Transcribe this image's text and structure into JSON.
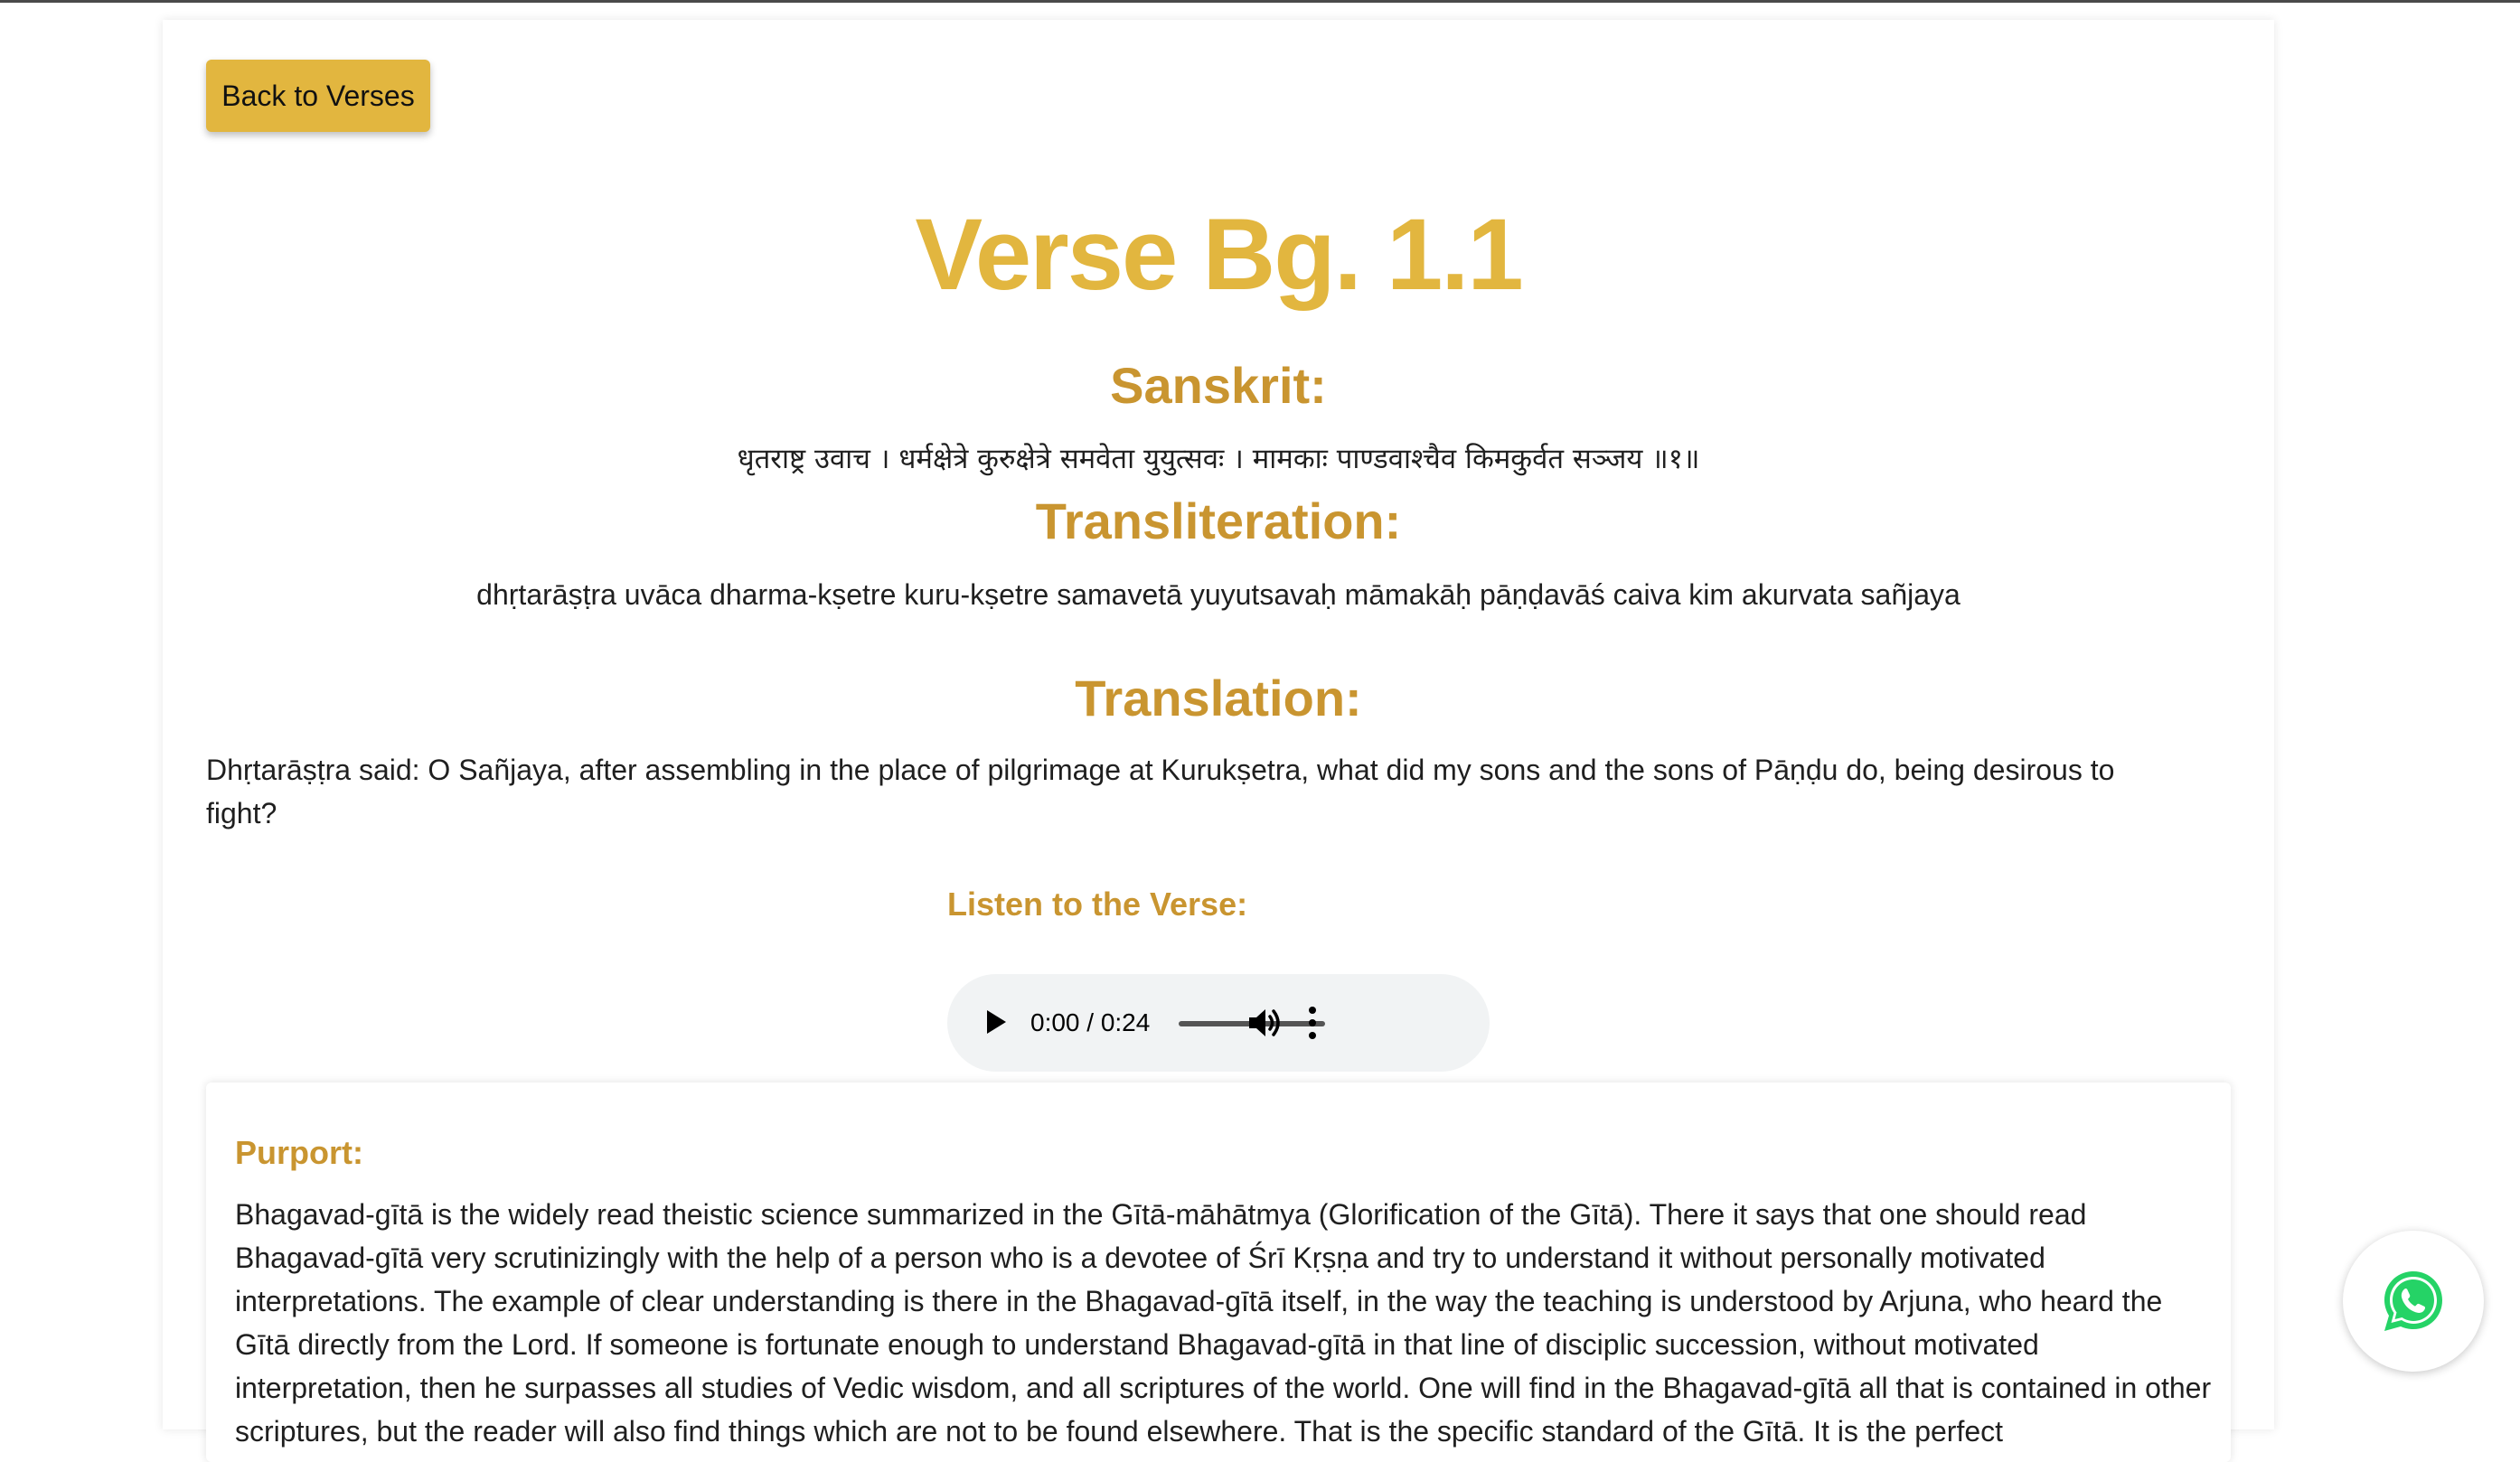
{
  "nav": {
    "back_label": "Back to Verses"
  },
  "verse": {
    "title": "Verse Bg. 1.1"
  },
  "sanskrit": {
    "heading": "Sanskrit:",
    "text": "धृतराष्ट्र उवाच । धर्मक्षेत्रे कुरुक्षेत्रे समवेता युयुत्सवः । मामकाः पाण्डवाश्चैव किमकुर्वत सञ्जय ॥१॥"
  },
  "transliteration": {
    "heading": "Transliteration:",
    "text": "dhṛtarāṣṭra uvāca dharma-kṣetre kuru-kṣetre samavetā yuyutsavaḥ māmakāḥ pāṇḍavāś caiva kim akurvata sañjaya"
  },
  "translation": {
    "heading": "Translation:",
    "text": "Dhṛtarāṣṭra said: O Sañjaya, after assembling in the place of pilgrimage at Kurukṣetra, what did my sons and the sons of Pāṇḍu do, being desirous to fight?"
  },
  "audio": {
    "heading": "Listen to the Verse:",
    "time": "0:00 / 0:24",
    "progress": 0,
    "play_icon": "play-icon",
    "volume_icon": "volume-icon",
    "more_icon": "more-options-icon"
  },
  "purport": {
    "heading": "Purport:",
    "text": "Bhagavad-gītā is the widely read theistic science summarized in the Gītā-māhātmya (Glorification of the Gītā). There it says that one should read Bhagavad-gītā very scrutinizingly with the help of a person who is a devotee of Śrī Kṛṣṇa and try to understand it without personally motivated interpretations. The example of clear understanding is there in the Bhagavad-gītā itself, in the way the teaching is understood by Arjuna, who heard the Gītā directly from the Lord. If someone is fortunate enough to understand Bhagavad-gītā in that line of disciplic succession, without motivated interpretation, then he surpasses all studies of Vedic wisdom, and all scriptures of the world. One will find in the Bhagavad-gītā all that is contained in other scriptures, but the reader will also find things which are not to be found elsewhere. That is the specific standard of the Gītā. It is the perfect"
  },
  "floating": {
    "whatsapp_icon": "whatsapp-icon"
  },
  "colors": {
    "accent": "#e2b63f",
    "heading": "#c99530",
    "whatsapp": "#25d366"
  }
}
